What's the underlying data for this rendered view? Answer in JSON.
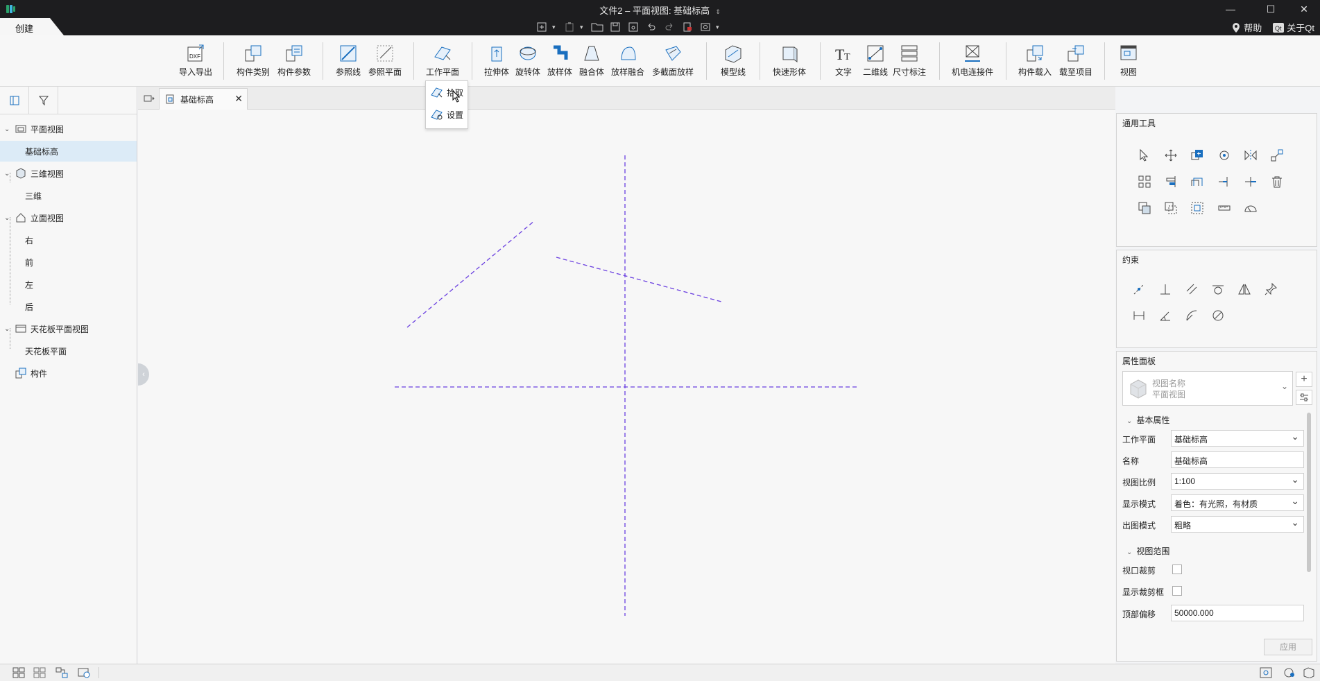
{
  "window": {
    "title": "文件2 – 平面视图: 基础标高",
    "title_arrow": "⇕",
    "minimize": "—",
    "maximize": "☐",
    "close": "✕"
  },
  "ribbon_tabs": {
    "create": "创建"
  },
  "help": {
    "help_label": "帮助",
    "about_label": "关于Qt"
  },
  "ribbon": {
    "buttons": [
      {
        "id": "import-export",
        "label": "导入导出",
        "icon": "dxf-icon"
      },
      {
        "id": "family-category",
        "label": "构件类别",
        "icon": "family-category-icon"
      },
      {
        "id": "family-params",
        "label": "构件参数",
        "icon": "family-params-icon"
      },
      {
        "id": "ref-line",
        "label": "参照线",
        "icon": "ref-line-icon"
      },
      {
        "id": "ref-plane",
        "label": "参照平面",
        "icon": "ref-plane-icon"
      },
      {
        "id": "work-plane",
        "label": "工作平面",
        "icon": "work-plane-icon"
      },
      {
        "id": "extrusion",
        "label": "拉伸体",
        "icon": "extrusion-icon"
      },
      {
        "id": "revolve",
        "label": "旋转体",
        "icon": "revolve-icon"
      },
      {
        "id": "sweep",
        "label": "放样体",
        "icon": "sweep-icon"
      },
      {
        "id": "blend",
        "label": "融合体",
        "icon": "blend-icon"
      },
      {
        "id": "swept-blend",
        "label": "放样融合",
        "icon": "swept-blend-icon"
      },
      {
        "id": "multi-section",
        "label": "多截面放样",
        "icon": "multi-section-icon"
      },
      {
        "id": "model-line",
        "label": "模型线",
        "icon": "model-line-icon"
      },
      {
        "id": "quick-shape",
        "label": "快速形体",
        "icon": "quick-shape-icon"
      },
      {
        "id": "text",
        "label": "文字",
        "icon": "text-icon"
      },
      {
        "id": "line-2d",
        "label": "二维线",
        "icon": "line-2d-icon"
      },
      {
        "id": "dimension",
        "label": "尺寸标注",
        "icon": "dimension-icon"
      },
      {
        "id": "mep-connector",
        "label": "机电连接件",
        "icon": "mep-connector-icon"
      },
      {
        "id": "load-family",
        "label": "构件载入",
        "icon": "load-family-icon"
      },
      {
        "id": "load-to-project",
        "label": "载至项目",
        "icon": "load-to-project-icon"
      },
      {
        "id": "view",
        "label": "视图",
        "icon": "view-icon"
      }
    ]
  },
  "workplane_menu": {
    "pick": "拾取",
    "settings": "设置"
  },
  "tree": {
    "plan_views": "平面视图",
    "base_level": "基础标高",
    "views_3d": "三维视图",
    "view_3d": "三维",
    "elevations": "立面视图",
    "right": "右",
    "front": "前",
    "left": "左",
    "back": "后",
    "ceiling_views": "天花板平面视图",
    "ceiling_plan": "天花板平面",
    "components": "构件"
  },
  "doc_tab": {
    "label": "基础标高",
    "close": "✕"
  },
  "general_tools": {
    "title": "通用工具"
  },
  "constraints": {
    "title": "约束"
  },
  "properties": {
    "title": "属性面板",
    "type_name": "视图名称",
    "type_sub": "平面视图",
    "section_basic": "基本属性",
    "rows": [
      {
        "label": "工作平面",
        "value": "基础标高"
      },
      {
        "label": "名称",
        "value": "基础标高"
      },
      {
        "label": "视图比例",
        "value": "1:100"
      },
      {
        "label": "显示模式",
        "value": "着色：有光照，有材质"
      },
      {
        "label": "出图模式",
        "value": "粗略"
      }
    ],
    "section_range": "视图范围",
    "viewport_crop": "视口裁剪",
    "show_crop_box": "显示裁剪框",
    "top_offset_label": "顶部偏移",
    "top_offset_value": "50000.000",
    "apply": "应用"
  },
  "colors": {
    "accent": "#1a6fbf",
    "ref_line": "#6a3fe0",
    "titlebar": "#1d1d1f"
  }
}
